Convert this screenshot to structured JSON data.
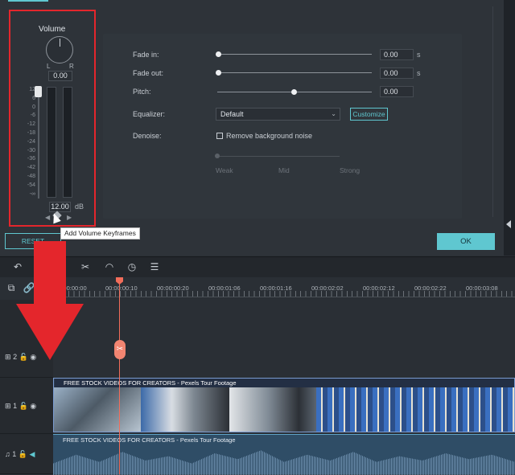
{
  "volume": {
    "title": "Volume",
    "left_label": "L",
    "right_label": "R",
    "pan_value": "0.00",
    "scale": [
      "12",
      "6",
      "0",
      "-6",
      "-12",
      "-18",
      "-24",
      "-30",
      "-36",
      "-42",
      "-48",
      "-54",
      "-∞"
    ],
    "gain_value": "12.00",
    "gain_unit": "dB"
  },
  "settings": {
    "fade_in_label": "Fade in:",
    "fade_in_value": "0.00",
    "fade_out_label": "Fade out:",
    "fade_out_value": "0.00",
    "seconds_unit": "s",
    "pitch_label": "Pitch:",
    "pitch_value": "0.00",
    "equalizer_label": "Equalizer:",
    "equalizer_value": "Default",
    "customize_label": "Customize",
    "denoise_label": "Denoise:",
    "denoise_checkbox_label": "Remove background noise",
    "denoise_levels": [
      "Weak",
      "Mid",
      "Strong"
    ]
  },
  "buttons": {
    "reset": "RESET",
    "ok": "OK"
  },
  "tooltip": "Add Volume Keyframes",
  "timeline": {
    "ruler_labels": [
      "00:00:00:00",
      "00:00:00:10",
      "00:00:00:20",
      "00:00:01:06",
      "00:00:01:16",
      "00:00:02:02",
      "00:00:02:12",
      "00:00:02:22",
      "00:00:03:08"
    ],
    "tracks": [
      {
        "number": "2"
      },
      {
        "number": "1"
      },
      {
        "number": "1"
      }
    ],
    "video_clip_title": "FREE STOCK VIDEOS FOR CREATORS - Pexels Tour Footage",
    "audio_clip_title": "FREE STOCK VIDEOS FOR CREATORS - Pexels Tour Footage"
  },
  "colors": {
    "accent": "#5fc7d0",
    "highlight_red": "#e4262c",
    "playhead": "#f26d5a"
  }
}
